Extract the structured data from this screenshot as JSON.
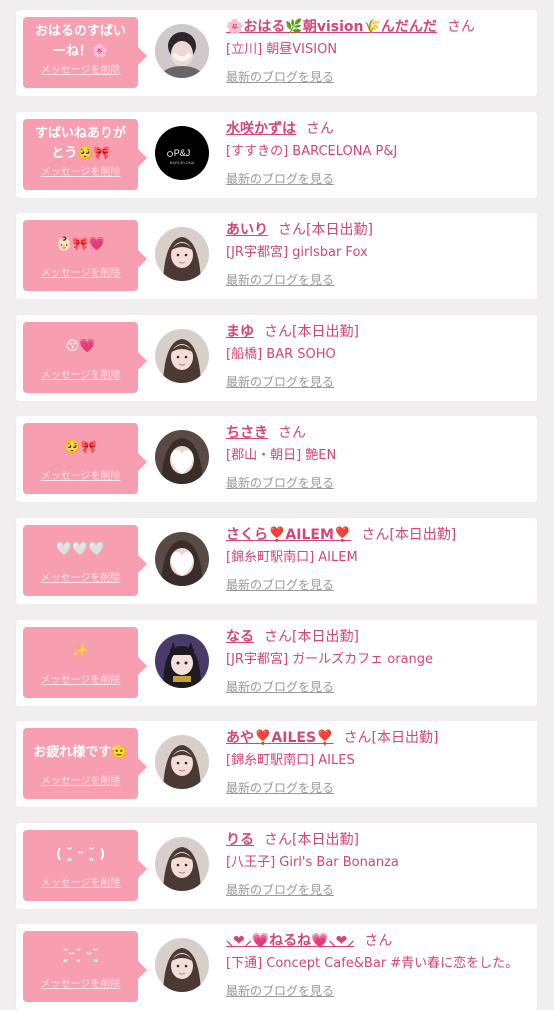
{
  "delete_label": "メッセージを削除",
  "blog_label": "最新のブログを見る",
  "san_label": "さん",
  "cards": [
    {
      "message": "おはるのすばいーね！🌸",
      "name": "🌸おはる🌿朝vision🌾んだんだ",
      "status": "",
      "shop": "[立川] 朝昼VISION",
      "avatar": "blurred-selfie-photo"
    },
    {
      "message": "すばいねありがとう🥺🎀",
      "name": "水咲かずは",
      "status": "",
      "shop": "[すすきの] BARCELONA P&J",
      "avatar": "barcelona-pj-logo"
    },
    {
      "message": "👶🏻🎀💗",
      "name": "あいり",
      "status": "[本日出勤]",
      "shop": "[JR宇都宮] girlsbar Fox",
      "avatar": "girl-photo"
    },
    {
      "message": "😚💗",
      "name": "まゆ",
      "status": "[本日出勤]",
      "shop": "[船橋] BAR SOHO",
      "avatar": "girl-photo"
    },
    {
      "message": "🥺🎀",
      "name": "ちさき",
      "status": "",
      "shop": "[郡山・朝日] 艶EN",
      "avatar": "heart-covered-photo"
    },
    {
      "message": "🤍🤍🤍",
      "name": "さくら❣️AILEM❣️",
      "status": "[本日出勤]",
      "shop": "[錦糸町駅南口] AILEM",
      "avatar": "heart-covered-photo"
    },
    {
      "message": "✨",
      "name": "なる",
      "status": "[本日出勤]",
      "shop": "[JR宇都宮] ガールズカフェ orange",
      "avatar": "cosplay-photo"
    },
    {
      "message": "お疲れ様です🫡",
      "name": "あや❣️AILES❣️",
      "status": "[本日出勤]",
      "shop": "[錦糸町駅南口] AILES",
      "avatar": "girl-photo"
    },
    {
      "message": "( ˘͈ ᵕ ˘͈ )",
      "name": "りる",
      "status": "[本日出勤]",
      "shop": "[八王子] Girl's Bar Bonanza",
      "avatar": "girl-photo"
    },
    {
      "message": "˘͈ᵕ˘͈ ᵕ˘͈",
      "name": "⸜❤︎⸝💗ねるね💗⸜❤︎⸝",
      "status": "",
      "shop": "[下通] Concept Cafe&Bar #青い春に恋をした。",
      "avatar": "girl-photo"
    }
  ]
}
